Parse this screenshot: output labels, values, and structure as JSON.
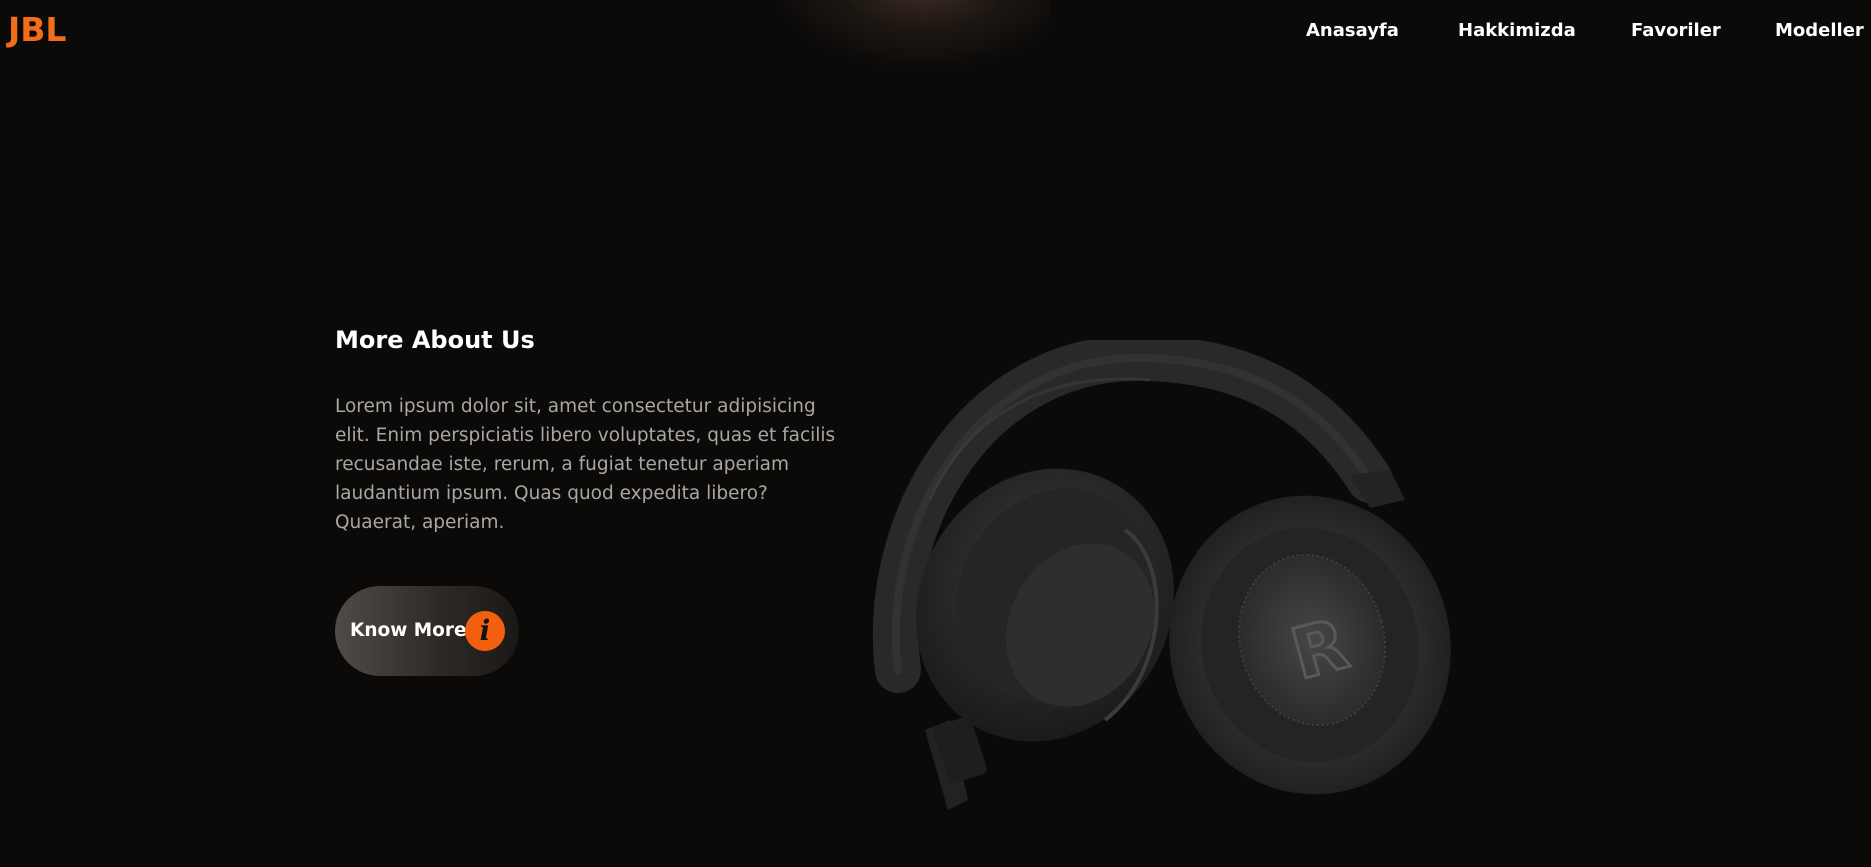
{
  "brand": {
    "logo": "JBL",
    "accent": "#f26c1b"
  },
  "nav": {
    "items": [
      {
        "label": "Anasayfa"
      },
      {
        "label": "Hakkimizda"
      },
      {
        "label": "Favoriler"
      },
      {
        "label": "Modeller"
      }
    ]
  },
  "about": {
    "title": "More About Us",
    "text": "Lorem ipsum dolor sit, amet consectetur adipisicing elit. Enim perspiciatis libero voluptates, quas et facilis recusandae iste, rerum, a fugiat tenetur aperiam laudantium ipsum. Quas quod expedita libero? Quaerat, aperiam.",
    "button_label": "Know More",
    "button_icon": "info-icon",
    "icon_glyph": "i"
  },
  "image": {
    "subject": "headphones-icon"
  }
}
